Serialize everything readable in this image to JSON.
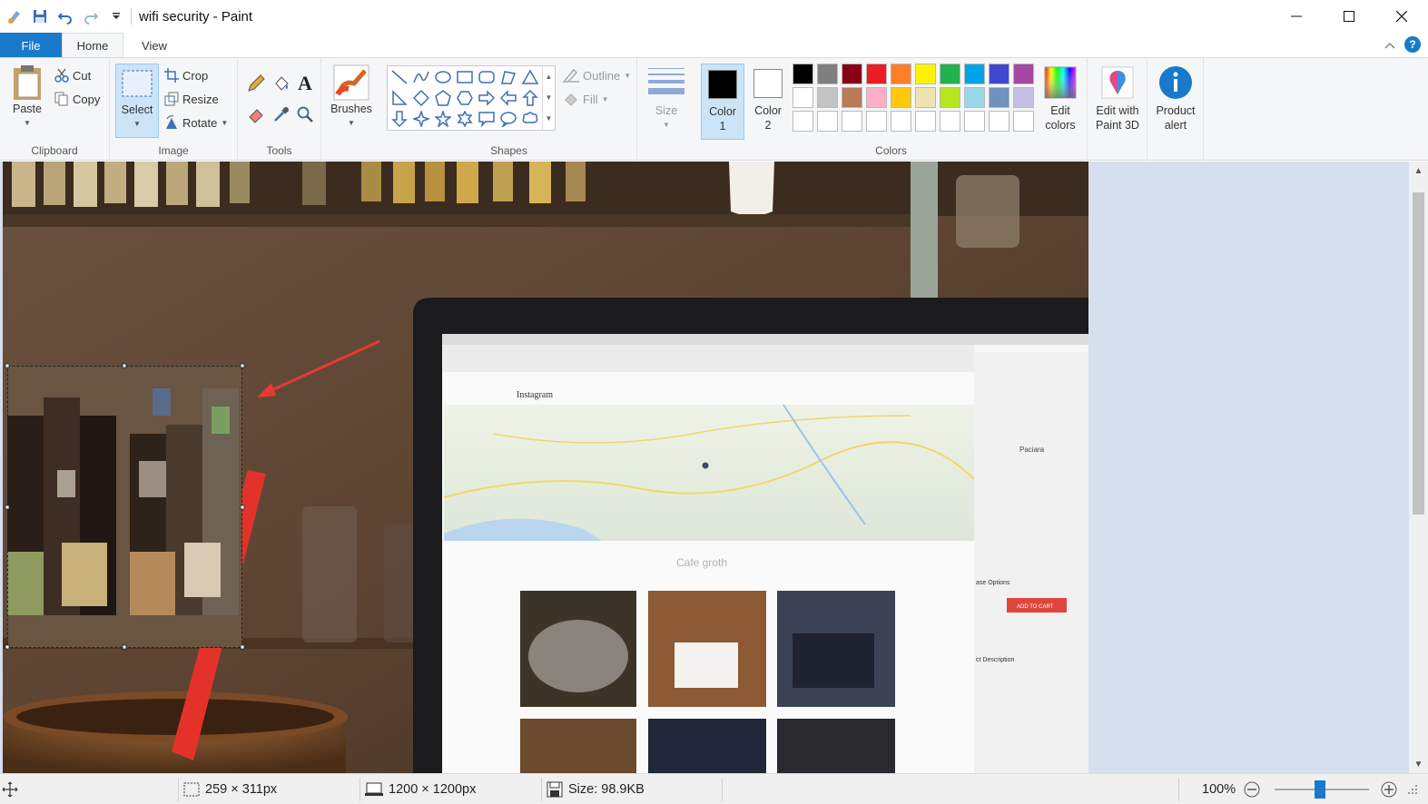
{
  "window": {
    "title": "wifi security - Paint"
  },
  "tabs": [
    {
      "label": "File"
    },
    {
      "label": "Home"
    },
    {
      "label": "View"
    }
  ],
  "ribbon": {
    "clipboard": {
      "label": "Clipboard",
      "paste": "Paste",
      "cut": "Cut",
      "copy": "Copy"
    },
    "image": {
      "label": "Image",
      "select": "Select",
      "crop": "Crop",
      "resize": "Resize",
      "rotate": "Rotate"
    },
    "tools": {
      "label": "Tools"
    },
    "brushes": {
      "label": "Brushes"
    },
    "shapes": {
      "label": "Shapes",
      "outline": "Outline",
      "fill": "Fill"
    },
    "size": {
      "label": "Size"
    },
    "colors": {
      "label": "Colors",
      "color1": {
        "label_line1": "Color",
        "label_line2": "1",
        "value": "#000000"
      },
      "color2": {
        "label_line1": "Color",
        "label_line2": "2",
        "value": "#ffffff"
      },
      "edit_colors": {
        "line1": "Edit",
        "line2": "colors"
      },
      "palette_row1": [
        "#000000",
        "#7f7f7f",
        "#880015",
        "#ed1c24",
        "#ff7f27",
        "#fff200",
        "#22b14c",
        "#00a2e8",
        "#3f48cc",
        "#a349a4"
      ],
      "palette_row2": [
        "#ffffff",
        "#c3c3c3",
        "#b97a57",
        "#ffaec9",
        "#ffc90e",
        "#efe4b0",
        "#b5e61d",
        "#99d9ea",
        "#7092be",
        "#c8bfe7"
      ],
      "palette_row3": [
        "#ffffff",
        "#ffffff",
        "#ffffff",
        "#ffffff",
        "#ffffff",
        "#ffffff",
        "#ffffff",
        "#ffffff",
        "#ffffff",
        "#ffffff"
      ]
    },
    "paint3d": {
      "line1": "Edit with",
      "line2": "Paint 3D"
    },
    "product_alert": {
      "line1": "Product",
      "line2": "alert"
    }
  },
  "canvas": {
    "screen_texts": {
      "brand": "Instagram",
      "heading": "Cafe groth",
      "store_name": "Paciara",
      "purchase": "ase Options",
      "cart_button": "ADD TO CART",
      "desc": "ct Description"
    }
  },
  "status": {
    "selection_size": "259 × 311px",
    "image_size": "1200 × 1200px",
    "file_size": "Size: 98.9KB",
    "zoom": "100%"
  }
}
